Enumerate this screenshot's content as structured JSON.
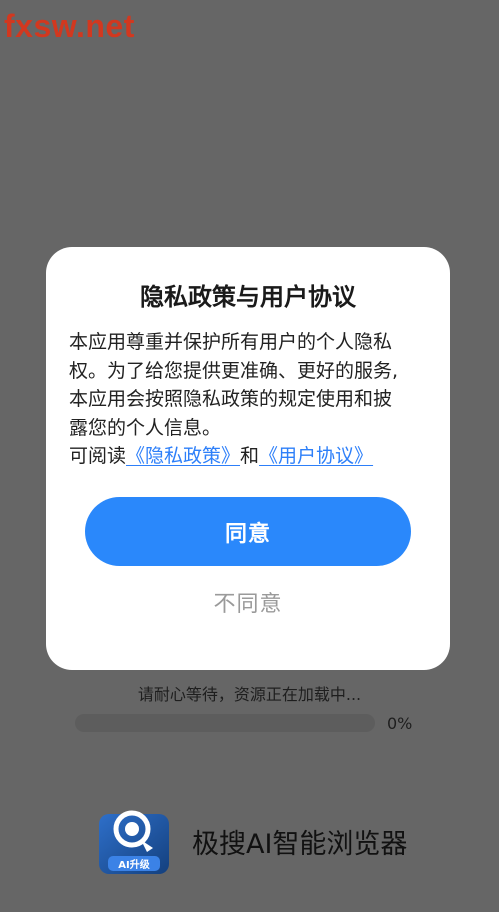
{
  "watermark": "fxsw.net",
  "dialog": {
    "title": "隐私政策与用户协议",
    "body_lines": [
      "本应用尊重并保护所有用户的个人隐私",
      "权。为了给您提供更准确、更好的服务,",
      "本应用会按照隐私政策的规定使用和披",
      "露您的个人信息。"
    ],
    "read_prefix": "可阅读",
    "privacy_link": "《隐私政策》",
    "and_text": "和",
    "agreement_link": "《用户协议》",
    "agree_label": "同意",
    "disagree_label": "不同意"
  },
  "loading": {
    "text": "请耐心等待，资源正在加载中...",
    "progress_percent": 0,
    "progress_label": "0%"
  },
  "app": {
    "logo_badge": "AI升级",
    "name": "极搜AI智能浏览器"
  },
  "colors": {
    "accent": "#2a88fb",
    "link": "#2d7ff9",
    "overlay_background": "#666666",
    "watermark": "#d2381f"
  }
}
